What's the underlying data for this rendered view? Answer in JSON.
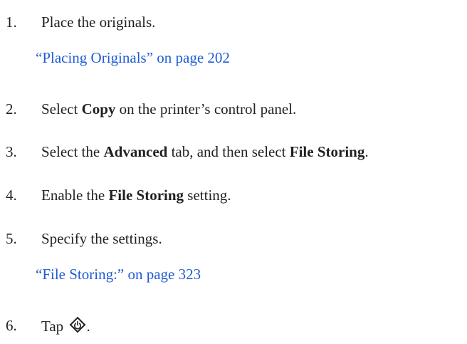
{
  "steps": [
    {
      "number": "1.",
      "parts": [
        "Place the originals."
      ],
      "link": "“Placing Originals” on page 202"
    },
    {
      "number": "2.",
      "parts": [
        "Select ",
        "Copy",
        " on the printer’s control panel."
      ]
    },
    {
      "number": "3.",
      "parts": [
        "Select the ",
        "Advanced",
        " tab, and then select ",
        "File Storing",
        "."
      ]
    },
    {
      "number": "4.",
      "parts": [
        "Enable the ",
        "File Storing",
        " setting."
      ]
    },
    {
      "number": "5.",
      "parts": [
        "Specify the settings."
      ],
      "link": "“File Storing:” on page 323"
    },
    {
      "number": "6.",
      "parts": [
        "Tap ",
        "."
      ],
      "icon": "start-button-icon"
    }
  ],
  "colors": {
    "text": "#231f20",
    "link": "#1f5bd6"
  }
}
